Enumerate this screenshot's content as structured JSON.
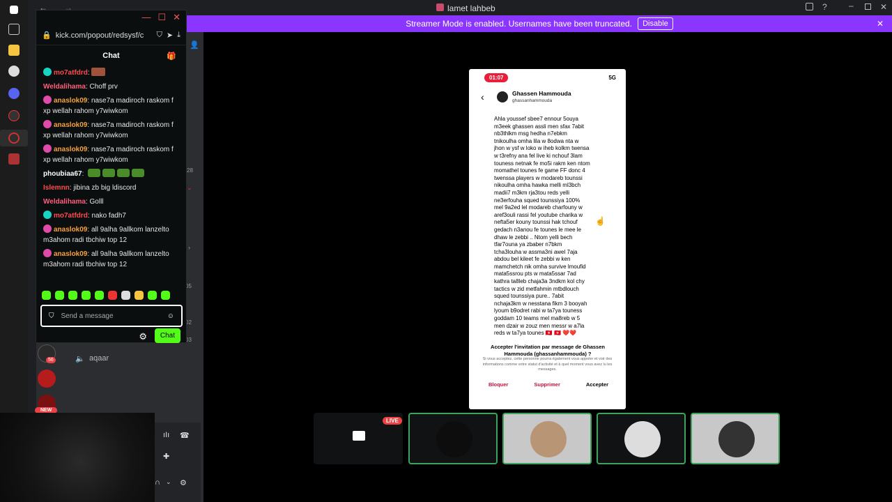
{
  "window": {
    "title": "lamet lahbeb"
  },
  "banner": {
    "text": "Streamer Mode is enabled. Usernames have been truncated.",
    "disable_label": "Disable"
  },
  "popout": {
    "url": "kick.com/popout/redsysf/c",
    "chat_title": "Chat",
    "messages": [
      {
        "user": "mo7atfdrd",
        "text": "",
        "style": "red",
        "badge": "#19d3c5"
      },
      {
        "user": "Weldalihama",
        "text": "Choff prv",
        "style": "pink",
        "badge": ""
      },
      {
        "user": "anaslok09",
        "text": "nase7a madiroch raskom f xp wellah rahom y7wiwkom",
        "style": "orange",
        "badge": "#e04aa8"
      },
      {
        "user": "anaslok09",
        "text": "nase7a madiroch raskom f xp wellah rahom y7wiwkom",
        "style": "orange",
        "badge": "#e04aa8"
      },
      {
        "user": "anaslok09",
        "text": "nase7a madiroch raskom f xp wellah rahom y7wiwkom",
        "style": "orange",
        "badge": "#e04aa8"
      },
      {
        "user": "phoubiaa67",
        "text": "",
        "style": "white",
        "badge": ""
      },
      {
        "user": "Islemnn",
        "text": "jibina zb big ldiscord",
        "style": "red",
        "badge": ""
      },
      {
        "user": "Weldalihama",
        "text": "Golll",
        "style": "pink",
        "badge": ""
      },
      {
        "user": "mo7atfdrd",
        "text": "nako fadh7",
        "style": "red",
        "badge": "#19d3c5"
      },
      {
        "user": "anaslok09",
        "text": "all 9alha 9allkom lanzelto m3ahom radi tbchiw top 12",
        "style": "orange",
        "badge": "#e04aa8"
      },
      {
        "user": "anaslok09",
        "text": "all 9alha 9allkom lanzelto m3ahom radi tbchiw top 12",
        "style": "orange",
        "badge": "#e04aa8"
      }
    ],
    "send_placeholder": "Send a message",
    "chat_button": "Chat"
  },
  "phone": {
    "time": "01:07",
    "signal": "5G",
    "profile_name": "Ghassen Hammouda",
    "profile_handle": "ghassanhammouda",
    "message_body": "Ahla youssef sbee7 ennour 5ouya\nm3eek ghassen assli men sfax 7abit\nnb3thlkm msg hedha n7ebkm\ntnikoulha omha lila w 8odwa nta w\njhon w ysf w loko w iheb kolkm twensa\nw t3refny ana fel live ki nchouf 3lam\ntouness netnak fe mo5i rakm ken ntom\nmomathel tounes fe game FF donc 4\ntwenssa players w modareb tounssi\nnikoulha omha hawka melli ml3bch\nmadii7 m3km rja3tou reds yelli\nne3erfouha squed tounssiya 100%\nmel 9a2ed lel modareb charfouny w\naref3ouli rassi fel youtube charika w\nnefta5er kouny tounssi hak tchouf\ngedach n3anou fe tounes le mee le\ndhaw le zebbi .. Ntom yelli bech\ntfar7ouna ya zbaber n7bkm\ntcha3louha w assma3ni awel 7aja\nabdou bel kileet fe zebbi w ken\nmamchetch nik omha survive lmoufid\nmata5ssrou pts w mata5ssar 7ad\nkathra ta8leb chaja3a 3ndkm kol chy\ntactics w zid metfahmin mtbdlouch\nsqued tounssiya pure.. 7abit\nnchaja3km w nesstana fikm 3 booyah\nlyoum b9odret rabi w ta7ya touness\ngoddam 10 teams mel ma8reb w 5\nmen dzair w zouz men messr w a7la\nreds w ta7ya tounes 🇹🇳 🇹🇳 ❤️❤️",
    "invite_title": "Accepter l'invitation par message de Ghassen Hammouda (ghassanhammouda) ?",
    "invite_note": "Si vous acceptez, cette personne pourra également vous appeler et voir des informations comme votre statut d'activité et à quel moment vous avez lu les messages.",
    "actions": {
      "block": "Bloquer",
      "delete": "Supprimer",
      "accept": "Accepter"
    }
  },
  "stage": {
    "live_badge": "LIVE"
  },
  "sidebar": {
    "member_name": "aqaar",
    "server_badge": "56",
    "new_badge": "NEW",
    "server_counts": [
      "28",
      "05",
      "02",
      "03"
    ]
  }
}
